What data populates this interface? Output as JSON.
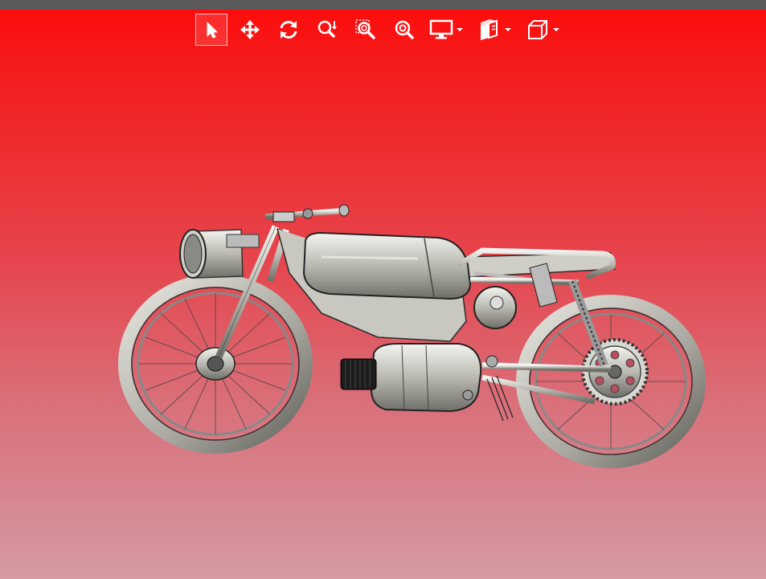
{
  "viewer": {
    "background_top": "#ff0a0a",
    "background_bottom": "#d59aa2",
    "topbar_color": "#5a5a5a"
  },
  "toolbar": {
    "tools": [
      {
        "name": "select",
        "icon": "cursor-arrow-icon",
        "active": true
      },
      {
        "name": "pan",
        "icon": "move-arrows-icon",
        "active": false
      },
      {
        "name": "rotate",
        "icon": "rotate-icon",
        "active": false
      },
      {
        "name": "zoom-in-out",
        "icon": "zoom-in-out-icon",
        "active": false
      },
      {
        "name": "zoom-window",
        "icon": "zoom-window-icon",
        "active": false
      },
      {
        "name": "zoom-fit",
        "icon": "zoom-fit-icon",
        "active": false
      }
    ],
    "dropdowns": [
      {
        "name": "display-style",
        "icon": "monitor-icon"
      },
      {
        "name": "section-view",
        "icon": "section-cube-icon"
      },
      {
        "name": "view-orientation",
        "icon": "cube-icon"
      }
    ]
  },
  "model": {
    "subject": "motorcycle",
    "icon": "motorcycle-model"
  }
}
